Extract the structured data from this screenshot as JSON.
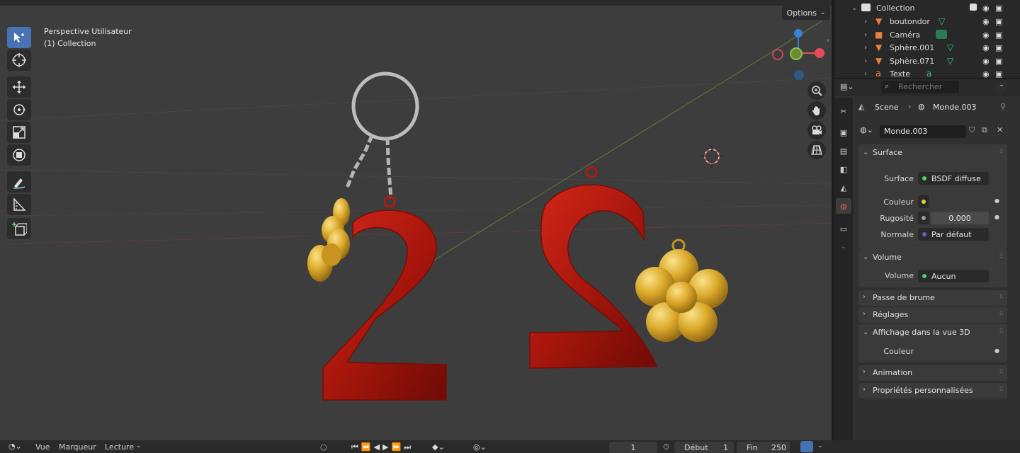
{
  "viewport": {
    "view_name": "Perspective Utilisateur",
    "collection_label": "(1) Collection",
    "options_label": "Options"
  },
  "tools": [
    "select-box-icon",
    "cursor-icon",
    "move-icon",
    "rotate-icon",
    "scale-icon",
    "transform-icon",
    "annotate-icon",
    "measure-icon",
    "add-cube-icon"
  ],
  "nav_gizmo": {
    "x_label": "X"
  },
  "outliner": {
    "collection": "Collection",
    "items": [
      {
        "name": "boutondor",
        "icon": "mesh-icon"
      },
      {
        "name": "Caméra",
        "icon": "camera-icon"
      },
      {
        "name": "Sphère.001",
        "icon": "mesh-icon"
      },
      {
        "name": "Sphère.071",
        "icon": "mesh-icon"
      },
      {
        "name": "Texte",
        "icon": "text-icon"
      }
    ]
  },
  "properties": {
    "search_placeholder": "Rechercher",
    "breadcrumb_scene": "Scene",
    "breadcrumb_world": "Monde.003",
    "world_name": "Monde.003",
    "surface_panel": {
      "title": "Surface",
      "surface_label": "Surface",
      "surface_value": "BSDF diffuse",
      "color_label": "Couleur",
      "roughness_label": "Rugosité",
      "roughness_value": "0.000",
      "normal_label": "Normale",
      "normal_value": "Par défaut"
    },
    "volume_panel": {
      "title": "Volume",
      "volume_label": "Volume",
      "volume_value": "Aucun"
    },
    "collapsed_panels": [
      "Passe de brume",
      "Réglages"
    ],
    "viewport_display_panel": {
      "title": "Affichage dans la vue 3D",
      "color_label": "Couleur"
    },
    "collapsed_panels_2": [
      "Animation",
      "Propriétés personnalisées"
    ]
  },
  "timeline": {
    "menu_view": "Vue",
    "menu_marker": "Marqueur",
    "menu_playback": "Lecture",
    "current_frame": "1",
    "start_label": "Début",
    "start_value": "1",
    "end_label": "Fin",
    "end_value": "250"
  },
  "colors": {
    "viewport_bg": "#3d3d3d",
    "active_tool": "#4772b3",
    "red_object": "#b01a10",
    "gold_object": "#d9a626",
    "axis_x": "#e84a5a",
    "axis_y": "#8bc34a",
    "axis_z": "#3b7fd6"
  }
}
